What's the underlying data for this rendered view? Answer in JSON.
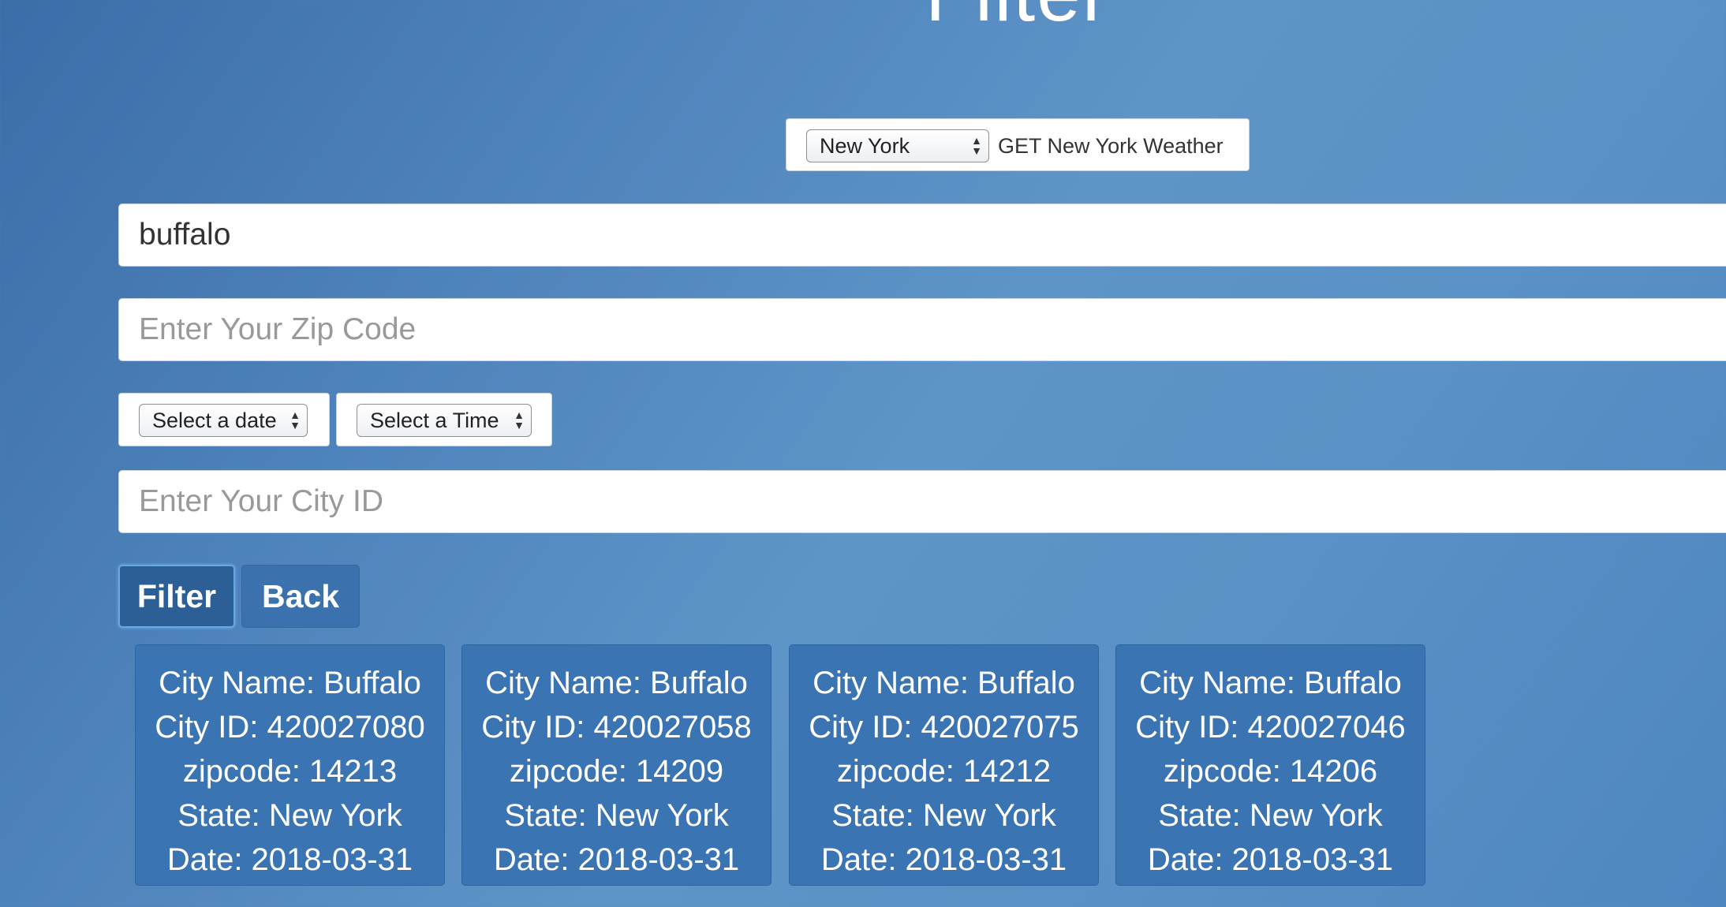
{
  "page": {
    "title": "Filter"
  },
  "state_selector": {
    "selected": "New York",
    "get_label": "GET New York Weather"
  },
  "inputs": {
    "city_name_value": "buffalo",
    "zip_placeholder": "Enter Your Zip Code",
    "city_id_placeholder": "Enter Your City ID"
  },
  "selects": {
    "date": "Select a date",
    "time": "Select a Time"
  },
  "buttons": {
    "filter": "Filter",
    "back": "Back"
  },
  "icons": {
    "select_arrows": "up-down-arrows-icon"
  },
  "results": [
    {
      "city_name": "City Name: Buffalo",
      "city_id": "City ID: 420027080",
      "zipcode": "zipcode: 14213",
      "state": "State: New York",
      "date": "Date: 2018-03-31"
    },
    {
      "city_name": "City Name: Buffalo",
      "city_id": "City ID: 420027058",
      "zipcode": "zipcode: 14209",
      "state": "State: New York",
      "date": "Date: 2018-03-31"
    },
    {
      "city_name": "City Name: Buffalo",
      "city_id": "City ID: 420027075",
      "zipcode": "zipcode: 14212",
      "state": "State: New York",
      "date": "Date: 2018-03-31"
    },
    {
      "city_name": "City Name: Buffalo",
      "city_id": "City ID: 420027046",
      "zipcode": "zipcode: 14206",
      "state": "State: New York",
      "date": "Date: 2018-03-31"
    }
  ],
  "colors": {
    "background": "#4f83bb",
    "card_background": "#3b74b2",
    "filter_button": "#2b5f95",
    "back_button": "#3b72ad"
  }
}
